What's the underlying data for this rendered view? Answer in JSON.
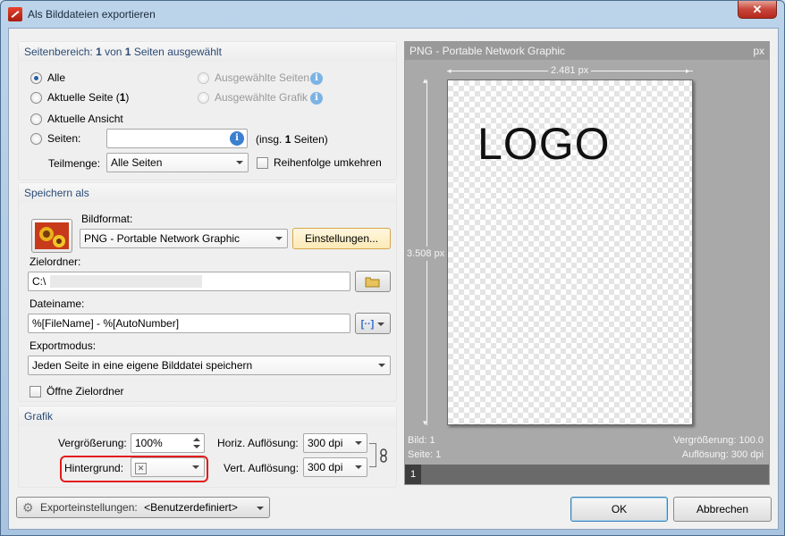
{
  "window": {
    "title": "Als Bilddateien exportieren",
    "close_glyph": "✕"
  },
  "page_range": {
    "heading_prefix": "Seitenbereich:",
    "heading_count": "1",
    "heading_mid": "von",
    "heading_total": "1",
    "heading_suffix": "Seiten ausgewählt",
    "options": {
      "all": "Alle",
      "current_page": "Aktuelle Seite (",
      "current_page_num": "1",
      "current_page_close": ")",
      "current_view": "Aktuelle Ansicht",
      "pages": "Seiten:",
      "selected_pages": "Ausgewählte Seiten",
      "selected_graphic": "Ausgewählte Grafik"
    },
    "selected": "all",
    "pages_input_value": "",
    "pages_total_prefix": "(insg.",
    "pages_total_num": "1",
    "pages_total_suffix": "Seiten)",
    "subset_label": "Teilmenge:",
    "subset_value": "Alle Seiten",
    "reverse_order_label": "Reihenfolge umkehren",
    "reverse_order_checked": false
  },
  "save_as": {
    "heading": "Speichern als",
    "format_label": "Bildformat:",
    "format_value": "PNG - Portable Network Graphic",
    "settings_button": "Einstellungen...",
    "folder_label": "Zielordner:",
    "folder_value": "C:\\",
    "filename_label": "Dateiname:",
    "filename_value": "%[FileName] - %[AutoNumber]",
    "export_mode_label": "Exportmodus:",
    "export_mode_value": "Jeden Seite in eine eigene Bilddatei speichern",
    "open_folder_label": "Öffne Zielordner",
    "open_folder_checked": false
  },
  "graphic": {
    "heading": "Grafik",
    "zoom_label": "Vergrößerung:",
    "zoom_value": "100%",
    "background_label": "Hintergrund:",
    "background_swatch": "✕",
    "horiz_res_label": "Horiz. Auflösung:",
    "horiz_res_value": "300 dpi",
    "vert_res_label": "Vert. Auflösung:",
    "vert_res_value": "300 dpi"
  },
  "preview": {
    "title": "PNG - Portable Network Graphic",
    "unit": "px",
    "width_label": "2.481 px",
    "height_label": "3.508 px",
    "logo_text": "LOGO",
    "image_info": "Bild: 1",
    "page_info": "Seite: 1",
    "zoom_info": "Vergrößerung: 100.0",
    "resolution_info": "Auflösung: 300 dpi",
    "page_number": "1"
  },
  "footer": {
    "export_settings_label": "Exporteinstellungen:",
    "export_settings_value": "<Benutzerdefiniert>",
    "ok_button": "OK",
    "cancel_button": "Abbrechen"
  },
  "colors": {
    "accent": "#2b4a75",
    "highlight": "#e41b1b",
    "preview_bg": "#a9a9a9"
  }
}
